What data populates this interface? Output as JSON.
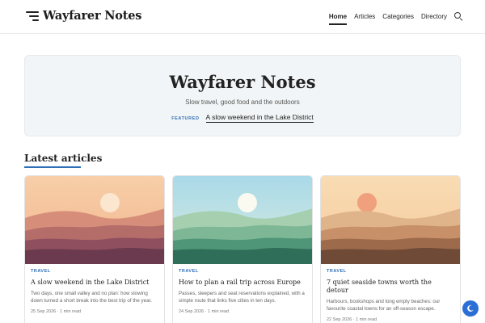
{
  "header": {
    "brand": "Wayfarer Notes",
    "nav": [
      {
        "label": "Home",
        "active": true
      },
      {
        "label": "Articles",
        "active": false
      },
      {
        "label": "Categories",
        "active": false
      },
      {
        "label": "Directory",
        "active": false
      }
    ],
    "icons": {
      "menu": "menu-icon",
      "search": "search-icon"
    }
  },
  "hero": {
    "title": "Wayfarer Notes",
    "subtitle": "Slow travel, good food and the outdoors",
    "featured_label": "FEATURED",
    "featured_link": "A slow weekend in the Lake District"
  },
  "latest": {
    "title": "Latest articles",
    "cards": [
      {
        "tag": "TRAVEL",
        "title": "A slow weekend in the Lake District",
        "description": "Two days, one small valley and no plan: how slowing down turned a short break into the best trip of the year.",
        "meta": "25 Sep 2026 · 1 min read",
        "sky": [
          "#f7cfa8",
          "#f2b48f"
        ],
        "sun": "#fbe6cf",
        "hills": [
          "#d68e7a",
          "#b56d6a",
          "#8f4f5e",
          "#6b3a4e"
        ]
      },
      {
        "tag": "TRAVEL",
        "title": "How to plan a rail trip across Europe",
        "description": "Passes, sleepers and seat reservations explained, with a simple route that links five cities in ten days.",
        "meta": "24 Sep 2026 · 1 min read",
        "sky": [
          "#a9d9e8",
          "#d8ecdf"
        ],
        "sun": "#fbfaf1",
        "hills": [
          "#a5cfae",
          "#7db796",
          "#4f9577",
          "#2f6e58"
        ]
      },
      {
        "tag": "TRAVEL",
        "title": "7 quiet seaside towns worth the detour",
        "description": "Harbours, bookshops and long empty beaches: our favourite coastal towns for an off-season escape.",
        "meta": "22 Sep 2026 · 1 min read",
        "sky": [
          "#f9dcb4",
          "#f5c99b"
        ],
        "sun": "#f0a07c",
        "hills": [
          "#e0b48a",
          "#c79068",
          "#9d6a4b",
          "#6f4a36"
        ]
      }
    ]
  },
  "fab": {
    "icon": "moon-icon",
    "color": "#2b6fd6"
  }
}
